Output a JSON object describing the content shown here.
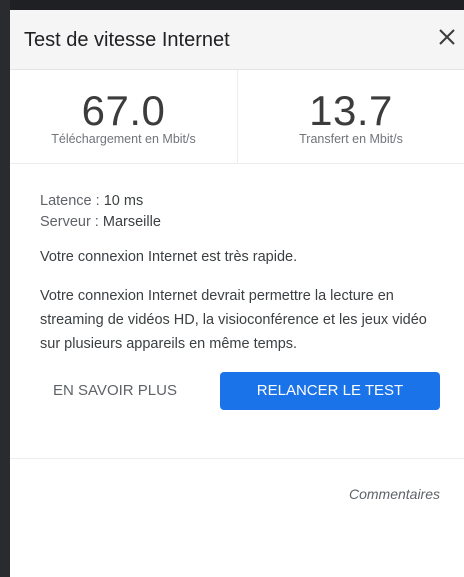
{
  "colors": {
    "accent": "#1a73e8",
    "header_bg": "#f5f5f5",
    "page_bg": "#202124",
    "text_primary": "#202124",
    "text_muted": "#70757a"
  },
  "header": {
    "title": "Test de vitesse Internet",
    "close_icon": "close-icon"
  },
  "metrics": {
    "download": {
      "value": "67.0",
      "label": "Téléchargement en Mbit/s"
    },
    "upload": {
      "value": "13.7",
      "label": "Transfert en Mbit/s"
    }
  },
  "stats": {
    "latency_label": "Latence",
    "latency_value": "10 ms",
    "server_label": "Serveur",
    "server_value": "Marseille"
  },
  "summary": "Votre connexion Internet est très rapide.",
  "details": "Votre connexion Internet devrait permettre la lecture en streaming de vidéos HD, la visioconférence et les jeux vidéo sur plusieurs appareils en même temps.",
  "actions": {
    "learn_more": "EN SAVOIR PLUS",
    "retest": "RELANCER LE TEST"
  },
  "feedback": "Commentaires"
}
